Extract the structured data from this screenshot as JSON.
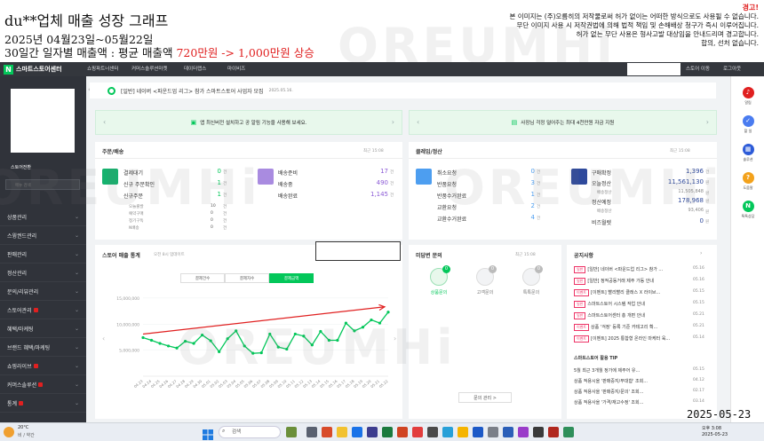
{
  "caption": {
    "title": "du**업체 매출 성장 그래프",
    "period": "2025년 04월23일~05월22일",
    "line_prefix": "30일간 일자별 매출액 : 평균 매출액 ",
    "line_highlight": "720만원 -> 1,000만원 상승",
    "warning_head": "경고!",
    "warning_lines": [
      "본 이미지는 (주)오름히의 저작물로써 허가 없이는 어떠한 방식으로도 사용될 수 없습니다.",
      "무단 이미지 사용 시 저작권법에 의해 법적 책임 및 손해배상 청구가 즉시 이루어집니다.",
      "허가 없는 무단 사용은 형사고발 대상임을 안내드리며 경고합니다.",
      "합의, 선처 없습니다."
    ],
    "watermark": "OREUMHi"
  },
  "topbar": {
    "brand": "스마트스토어센터",
    "nav": [
      "쇼핑파트너센터",
      "커머스솔루션마켓",
      "데이터랩스",
      "마이비즈"
    ],
    "right": [
      "스토어 이동",
      "로그아웃"
    ]
  },
  "sidebar": {
    "store_label": "스토어전환",
    "search_placeholder": "메뉴 검색",
    "items": [
      {
        "label": "상품관리",
        "badge": false
      },
      {
        "label": "스윙권드관리",
        "badge": false
      },
      {
        "label": "판매관리",
        "badge": false
      },
      {
        "label": "정산관리",
        "badge": false
      },
      {
        "label": "문의/리뷰관리",
        "badge": false
      },
      {
        "label": "스토어관리",
        "badge": true
      },
      {
        "label": "혜택/마케팅",
        "badge": false
      },
      {
        "label": "브랜드 혜택/마케팅",
        "badge": false
      },
      {
        "label": "쇼핑라이브",
        "badge": true
      },
      {
        "label": "커머스솔루션",
        "badge": true
      },
      {
        "label": "통계",
        "badge": true
      }
    ]
  },
  "notice": {
    "text": "[일반] 네이버 <파운드업 리그> 참가 스마트스토어 사업자 모집",
    "date": "2025.05.16."
  },
  "banners": [
    {
      "text": "앱 최신버전 설치하고 공 알림 기능을 사용해 보세요."
    },
    {
      "text": "사장님 걱정 덜어주는 최대 4천만원 자금 지원"
    }
  ],
  "orders": {
    "title": "주문/배송",
    "time": "최근 15:08",
    "left": [
      {
        "label": "결제대기",
        "value": "0",
        "unit": "건"
      },
      {
        "label": "신규 주문확인",
        "value": "1",
        "unit": "건"
      },
      {
        "label": "신규주문",
        "value": "1",
        "unit": "건"
      }
    ],
    "sub": [
      {
        "label": "오늘출발",
        "value": "10",
        "unit": "건"
      },
      {
        "label": "예약구매",
        "value": "0",
        "unit": "건"
      },
      {
        "label": "정기구독",
        "value": "0",
        "unit": "건"
      },
      {
        "label": "N배송",
        "value": "0",
        "unit": "건"
      }
    ],
    "right": [
      {
        "label": "배송준비",
        "value": "17",
        "unit": "건"
      },
      {
        "label": "배송중",
        "value": "490",
        "unit": "건"
      },
      {
        "label": "배송완료",
        "value": "1,145",
        "unit": "건"
      }
    ]
  },
  "claims": {
    "title": "클레임/정산",
    "time": "최근 15:08",
    "left": [
      {
        "label": "취소요청",
        "value": "0",
        "unit": "건"
      },
      {
        "label": "반품요청",
        "value": "3",
        "unit": "건"
      },
      {
        "label": "반품수거완료",
        "value": "1",
        "unit": "건"
      },
      {
        "label": "교환요청",
        "value": "2",
        "unit": "건"
      },
      {
        "label": "교환수거완료",
        "value": "4",
        "unit": "건"
      }
    ],
    "right": [
      {
        "label": "구매확정",
        "value": "1,396",
        "unit": "건"
      },
      {
        "label": "오늘정산",
        "value": "11,561,130",
        "unit": "원"
      },
      {
        "label": "배송정산",
        "value": "11,505,848",
        "unit": "원"
      },
      {
        "label": "정산예정",
        "value": "178,968",
        "unit": "원"
      },
      {
        "label": "배송정산",
        "value": "93,406",
        "unit": "원"
      },
      {
        "label": "비즈월렛",
        "value": "0",
        "unit": "원"
      }
    ]
  },
  "stats": {
    "title": "스토어 매출 통계",
    "subtitle": "오전 8시 업데이트",
    "tabs": [
      "결제건수",
      "결제자수",
      "결제금액"
    ],
    "active_tab": 2
  },
  "chart_data": {
    "type": "line",
    "title": "",
    "xlabel": "",
    "ylabel": "",
    "x": [
      "04.23",
      "04.24",
      "04.25",
      "04.26",
      "04.27",
      "04.28",
      "04.29",
      "04.30",
      "05.01",
      "05.02",
      "05.03",
      "05.04",
      "05.05",
      "05.06",
      "05.07",
      "05.08",
      "05.09",
      "05.10",
      "05.11",
      "05.12",
      "05.13",
      "05.14",
      "05.15",
      "05.16",
      "05.17",
      "05.18",
      "05.19",
      "05.20",
      "05.21",
      "05.22"
    ],
    "values": [
      7400000,
      6900000,
      6300000,
      5800000,
      5400000,
      6700000,
      6300000,
      7900000,
      6800000,
      4700000,
      7200000,
      8700000,
      5800000,
      4400000,
      4500000,
      8100000,
      5600000,
      5200000,
      8100000,
      7700000,
      6000000,
      8600000,
      6900000,
      6900000,
      10200000,
      8700000,
      9400000,
      10800000,
      10200000,
      12300000
    ],
    "yticks": [
      "15,000,000",
      "10,000,000",
      "5,000,000"
    ],
    "ylim": [
      0,
      16000000
    ],
    "line_color": "#03c75a",
    "trend_color": "#e02020",
    "grid": true
  },
  "inquiries": {
    "title": "미답변 문의",
    "time": "최근 15:08",
    "items": [
      {
        "label": "상품문의",
        "count": "0"
      },
      {
        "label": "고객문의",
        "count": "0"
      },
      {
        "label": "톡톡문의",
        "count": "0"
      }
    ],
    "button": "문의 관리 >"
  },
  "notices": {
    "title": "공지사항",
    "rows": [
      {
        "tag": "일반",
        "text": "[일반] 네이버 <파운드업 리그> 참가 ...",
        "date": "05.16"
      },
      {
        "tag": "일반",
        "text": "[일반] 정적공동거래 제주 가동 안내",
        "date": "05.16"
      },
      {
        "tag": "이벤트",
        "text": "[이벤트] 빨리빨리 클래스 X 라이브...",
        "date": "05.15"
      },
      {
        "tag": "일반",
        "text": "스마트스토어 시스템 작업 안내",
        "date": "05.15"
      },
      {
        "tag": "일반",
        "text": "스마트스토어센터 총 개편 안내",
        "date": "05.21"
      },
      {
        "tag": "이벤트",
        "text": "상품 '걱정' 등록 기준 카테고리 확...",
        "date": "05.21"
      },
      {
        "tag": "이벤트",
        "text": "[이벤트] 2025 통합형 온라인 마케터 육...",
        "date": "05.14"
      }
    ],
    "tips_title": "스마트스토어 활용 TIP",
    "tips": [
      {
        "text": "5월 최근 3개월 정가에 제주어 유...",
        "date": "05.15"
      },
      {
        "text": "상품 적용시을 '판매중지/부대합' 조회...",
        "date": "04.12"
      },
      {
        "text": "상품 적용사을 '판매중지/문의' 조회...",
        "date": "02.17"
      },
      {
        "text": "상품 적용사을 '가격/재고수정' 조회...",
        "date": "03.14"
      }
    ]
  },
  "rightbar": [
    {
      "label": "알림",
      "color": "#e02020",
      "glyph": "bell-icon"
    },
    {
      "label": "할 일",
      "color": "#4a7cf0",
      "glyph": "check-icon"
    },
    {
      "label": "솔루션",
      "color": "#2d5bd8",
      "glyph": "grid-icon"
    },
    {
      "label": "도움말",
      "color": "#f3a21c",
      "glyph": "question-icon"
    },
    {
      "label": "톡톡상담",
      "color": "#03c75a",
      "glyph": "chat-icon"
    }
  ],
  "taskbar": {
    "weather_temp": "20°C",
    "weather_desc": "비 / 약간",
    "search": "검색",
    "clock_time": "오후 3:08",
    "clock_date": "2025-05-23"
  },
  "stamp": "2025-05-23"
}
